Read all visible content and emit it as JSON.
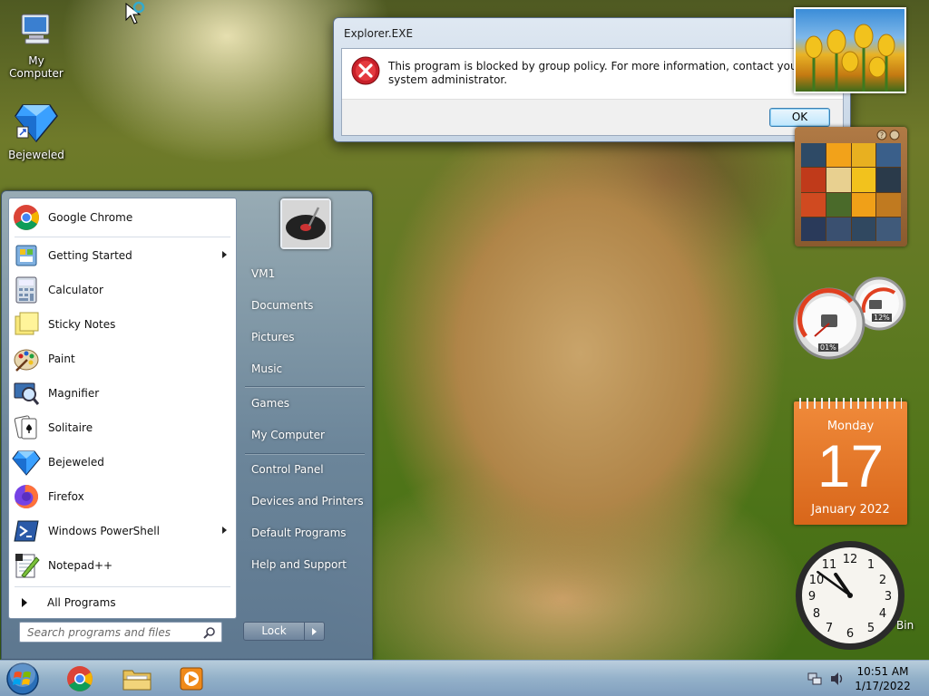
{
  "desktop": {
    "icons": [
      {
        "label": "My Computer",
        "icon": "computer-icon"
      },
      {
        "label": "Bejeweled",
        "icon": "diamond-icon"
      }
    ],
    "recycle_bin_label": "Bin"
  },
  "dialog": {
    "title": "Explorer.EXE",
    "close_label": "✕",
    "message": "This program is blocked by group policy. For more information, contact your system administrator.",
    "ok_label": "OK",
    "icon": "error-icon"
  },
  "start_menu": {
    "programs": [
      {
        "label": "Google Chrome",
        "icon": "chrome-icon",
        "submenu": false
      },
      {
        "label": "Getting Started",
        "icon": "getting-started-icon",
        "submenu": true
      },
      {
        "label": "Calculator",
        "icon": "calculator-icon",
        "submenu": false
      },
      {
        "label": "Sticky Notes",
        "icon": "sticky-notes-icon",
        "submenu": false
      },
      {
        "label": "Paint",
        "icon": "paint-icon",
        "submenu": false
      },
      {
        "label": "Magnifier",
        "icon": "magnifier-icon",
        "submenu": false
      },
      {
        "label": "Solitaire",
        "icon": "solitaire-icon",
        "submenu": false
      },
      {
        "label": "Bejeweled",
        "icon": "diamond-icon",
        "submenu": false
      },
      {
        "label": "Firefox",
        "icon": "firefox-icon",
        "submenu": false
      },
      {
        "label": "Windows PowerShell",
        "icon": "powershell-icon",
        "submenu": true
      },
      {
        "label": "Notepad++",
        "icon": "notepadpp-icon",
        "submenu": false
      }
    ],
    "all_programs_label": "All Programs",
    "search_placeholder": "Search programs and files",
    "right_items": [
      "VM1",
      "Documents",
      "Pictures",
      "Music",
      "Games",
      "My Computer",
      "Control Panel",
      "Devices and Printers",
      "Default Programs",
      "Help and Support"
    ],
    "lock_label": "Lock"
  },
  "gadgets": {
    "cpu_meter": {
      "cpu": "01%",
      "memory": "12%"
    },
    "calendar": {
      "weekday": "Monday",
      "day": "17",
      "month_year": "January 2022"
    },
    "clock": {
      "hour": 10,
      "minute": 51
    }
  },
  "taskbar": {
    "apps": [
      "chrome-icon",
      "explorer-icon",
      "media-player-icon"
    ],
    "time": "10:51 AM",
    "date": "1/17/2022"
  },
  "colors": {
    "accent": "#3c7fb1",
    "error_red": "#c8202a",
    "calendar_orange": "#e8761f"
  }
}
